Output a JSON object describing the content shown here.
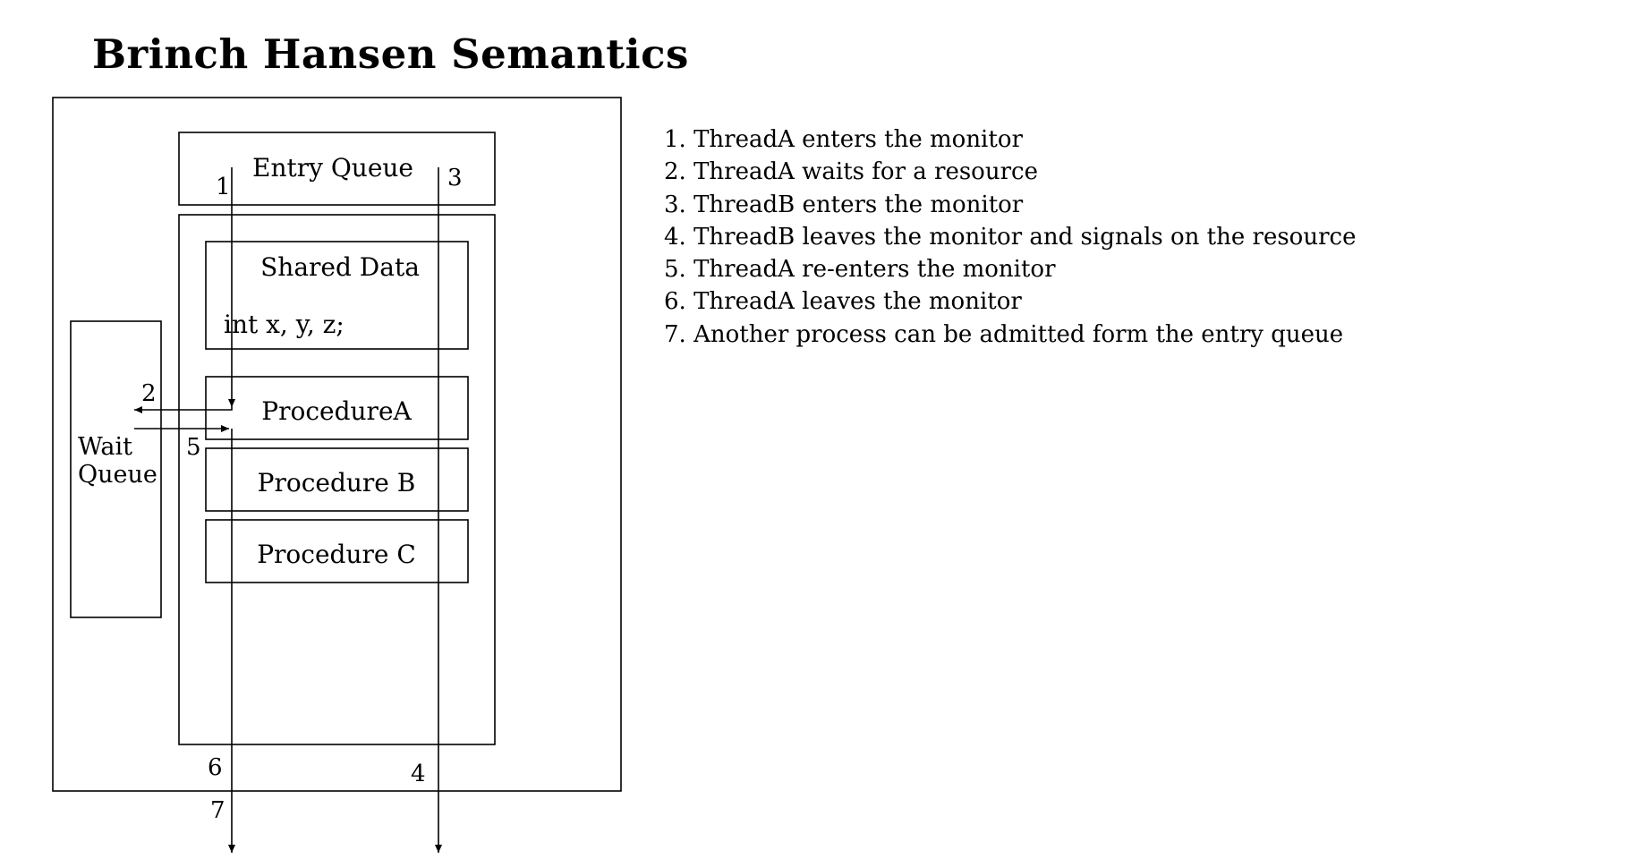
{
  "title": "Brinch Hansen Semantics",
  "diagram": {
    "entry_queue": "Entry Queue",
    "shared_data": "Shared Data",
    "shared_vars": "int x, y, z;",
    "wait_queue": [
      "Wait",
      "Queue"
    ],
    "procedures": [
      "ProcedureA",
      "Procedure B",
      "Procedure C"
    ],
    "markers": {
      "m1": "1",
      "m2": "2",
      "m3": "3",
      "m4": "4",
      "m5": "5",
      "m6": "6",
      "m7": "7"
    }
  },
  "steps": [
    "1. ThreadA enters the monitor",
    "2. ThreadA waits for a resource",
    "3. ThreadB enters the monitor",
    "4. ThreadB leaves the monitor and  signals on the resource",
    "5. ThreadA re-enters the monitor",
    "6. ThreadA leaves the monitor",
    "7. Another process can be admitted form the entry queue"
  ]
}
